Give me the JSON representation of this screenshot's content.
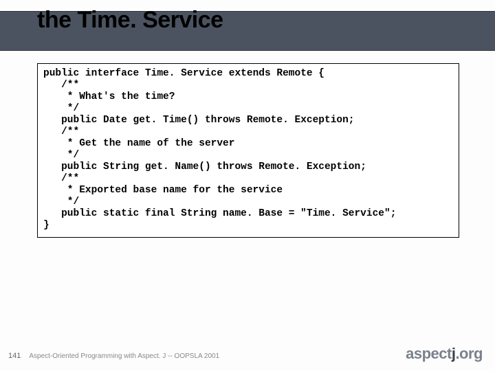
{
  "title": "the Time. Service",
  "code": {
    "l0_pre": "public interface ",
    "l0_name": "Time. Service ",
    "l0_ext": "extends ",
    "l0_rem": "Remote {",
    "blank": "",
    "c1a": "   /**",
    "c1b": "    * What's the time?",
    "c1c": "    */",
    "m1_pre": "   public ",
    "m1_type": "Date get. Time() ",
    "m1_thr": "throws ",
    "m1_exc": "Remote. Exception;",
    "c2a": "   /**",
    "c2b": "    * Get the name of the server",
    "c2c": "    */",
    "m2_pre": "   public ",
    "m2_type": "String get. Name() ",
    "m2_thr": "throws ",
    "m2_exc": "Remote. Exception;",
    "c3a": "   /**",
    "c3b": "    * Exported base name for the service",
    "c3c": "    */",
    "m3_pre": "   public static final ",
    "m3_type": "String name. Base = \"Time. Service\";",
    "end": "}"
  },
  "page_number": "141",
  "footer": "Aspect-Oriented Programming with Aspect. J -- OOPSLA 2001",
  "logo_a": "aspect",
  "logo_b": "j",
  "logo_c": ".org"
}
